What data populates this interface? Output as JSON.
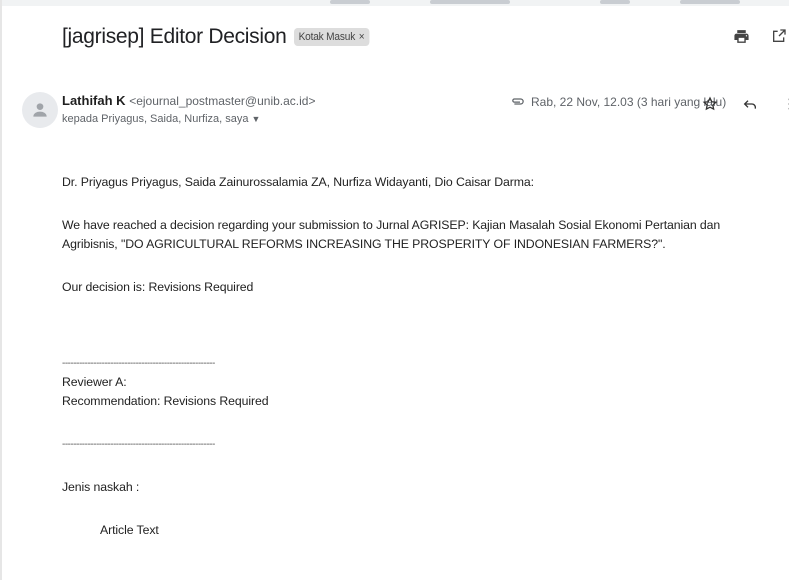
{
  "subject": "[jagrisep] Editor Decision",
  "label_chip": {
    "text": "Kotak Masuk",
    "close": "×"
  },
  "sender": {
    "name": "Lathifah K",
    "email": "<ejournal_postmaster@unib.ac.id>",
    "recipients": "kepada Priyagus, Saida, Nurfiza, saya",
    "recipients_caret": "▼"
  },
  "meta": {
    "date": "Rab, 22 Nov, 12.03 (3 hari yang lalu)"
  },
  "icons": {
    "print": "print-icon",
    "open_new_window": "open-in-new-window-icon",
    "avatar": "person-avatar-icon",
    "attachment": "attachment-icon",
    "star": "star-icon",
    "reply": "reply-icon",
    "more": "more-vertical-icon"
  },
  "body": {
    "greeting": "Dr. Priyagus Priyagus, Saida Zainurossalamia ZA, Nurfiza Widayanti, Dio Caisar Darma:",
    "paragraph1": "We have reached a decision regarding your submission to Jurnal AGRISEP: Kajian Masalah Sosial Ekonomi Pertanian dan Agribisnis, \"DO AGRICULTURAL REFORMS INCREASING THE PROSPERITY OF INDONESIAN FARMERS?\".",
    "decision": "Our decision is: Revisions Required",
    "separator": "------------------------------------------------------",
    "reviewer": "Reviewer A:",
    "recommendation": "Recommendation: Revisions Required",
    "separator2": "------------------------------------------------------",
    "jenis": "Jenis naskah :",
    "article": "Article Text"
  }
}
